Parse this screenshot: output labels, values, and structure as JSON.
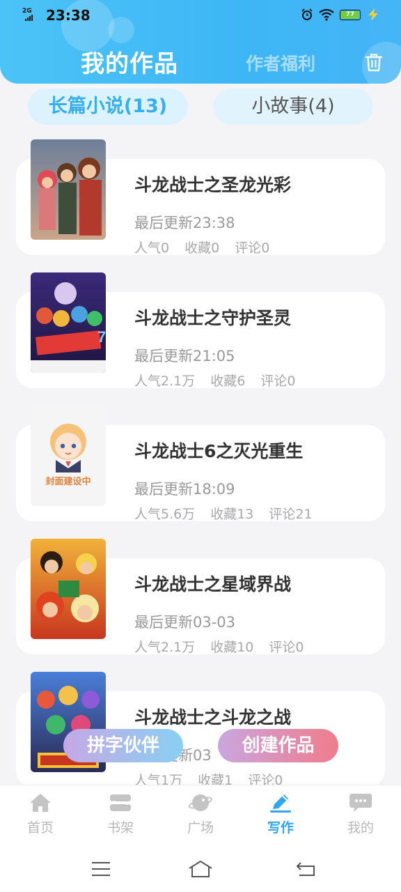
{
  "status_bar": {
    "network": "2G",
    "time": "23:38",
    "battery": "77"
  },
  "header": {
    "title": "我的作品",
    "secondary_tab": "作者福利"
  },
  "tabs": [
    {
      "label": "长篇小说(13)",
      "active": true
    },
    {
      "label": "小故事(4)",
      "active": false
    }
  ],
  "works": [
    {
      "title": "斗龙战士之圣龙光彩",
      "updated": "最后更新23:38",
      "popularity": "人气0",
      "favorites": "收藏0",
      "comments": "评论0"
    },
    {
      "title": "斗龙战士之守护圣灵",
      "updated": "最后更新21:05",
      "popularity": "人气2.1万",
      "favorites": "收藏6",
      "comments": "评论0"
    },
    {
      "title": "斗龙战士6之灭光重生",
      "updated": "最后更新18:09",
      "popularity": "人气5.6万",
      "favorites": "收藏13",
      "comments": "评论21",
      "cover_text": "封面建设中"
    },
    {
      "title": "斗龙战士之星域界战",
      "updated": "最后更新03-03",
      "popularity": "人气2.1万",
      "favorites": "收藏10",
      "comments": "评论0"
    },
    {
      "title": "斗龙战士之斗龙之战",
      "updated": "最后更新03",
      "popularity": "人气1万",
      "favorites": "收藏1",
      "comments": "评论0"
    }
  ],
  "floating_buttons": {
    "partner": "拼字伙伴",
    "create": "创建作品"
  },
  "bottom_nav": [
    {
      "label": "首页",
      "icon": "home-icon"
    },
    {
      "label": "书架",
      "icon": "bookshelf-icon"
    },
    {
      "label": "广场",
      "icon": "planet-icon"
    },
    {
      "label": "写作",
      "icon": "pen-icon",
      "active": true
    },
    {
      "label": "我的",
      "icon": "chat-bubble-icon"
    }
  ],
  "colors": {
    "header": "#3db6f5",
    "accent": "#2fa6ee",
    "create_gradient_end": "#f07c8c"
  }
}
